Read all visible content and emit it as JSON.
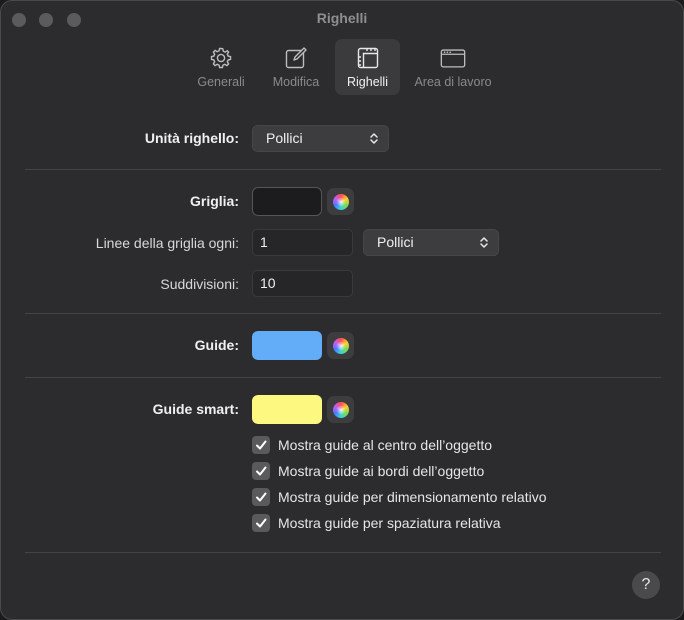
{
  "window": {
    "title": "Righelli"
  },
  "tabs": [
    {
      "label": "Generali",
      "icon": "gear-icon",
      "active": false
    },
    {
      "label": "Modifica",
      "icon": "edit-icon",
      "active": false
    },
    {
      "label": "Righelli",
      "icon": "ruler-icon",
      "active": true
    },
    {
      "label": "Area di lavoro",
      "icon": "window-icon",
      "active": false
    }
  ],
  "ruler_units": {
    "label": "Unità righello:",
    "value": "Pollici"
  },
  "grid": {
    "label": "Griglia:",
    "color": "#1c1c1e",
    "lines_label": "Linee della griglia ogni:",
    "lines_value": "1",
    "lines_unit": "Pollici",
    "subdivisions_label": "Suddivisioni:",
    "subdivisions_value": "10"
  },
  "guides": {
    "label": "Guide:",
    "color": "#63acf7"
  },
  "smart_guides": {
    "label": "Guide smart:",
    "color": "#fdf980",
    "options": [
      {
        "label": "Mostra guide al centro dell’oggetto",
        "checked": true
      },
      {
        "label": "Mostra guide ai bordi dell’oggetto",
        "checked": true
      },
      {
        "label": "Mostra guide per dimensionamento relativo",
        "checked": true
      },
      {
        "label": "Mostra guide per spaziatura relativa",
        "checked": true
      }
    ]
  },
  "help": {
    "label": "?"
  }
}
